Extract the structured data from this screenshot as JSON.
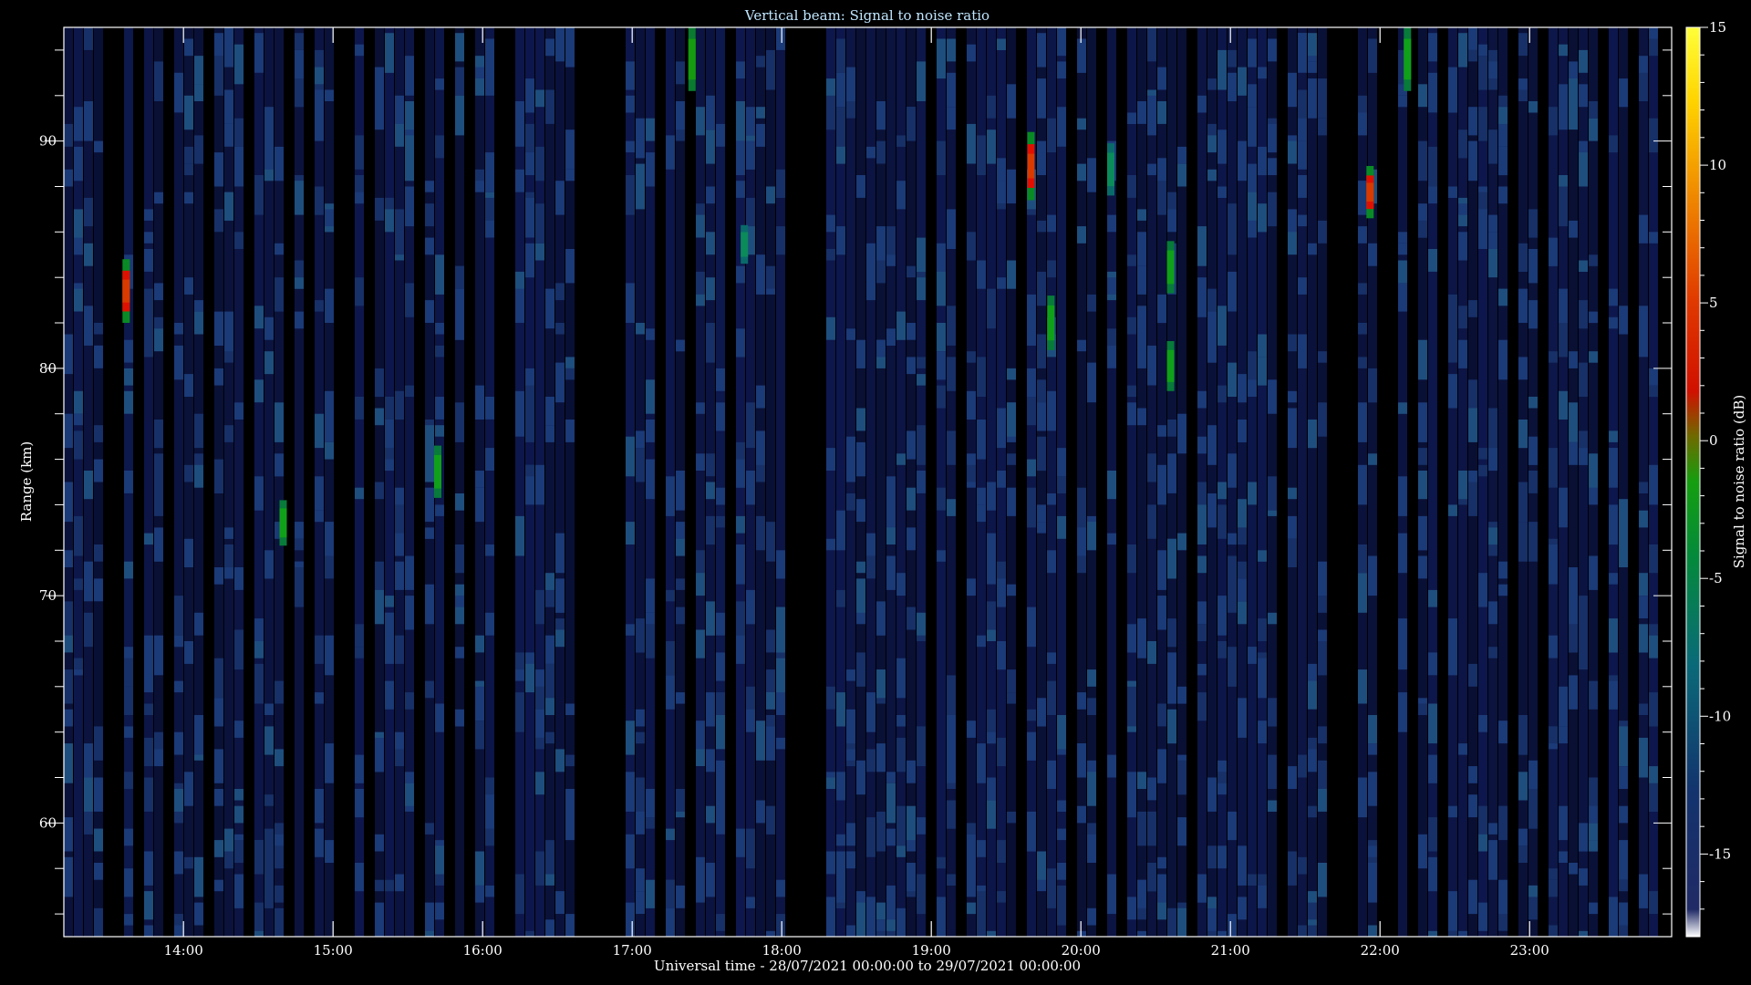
{
  "chart_data": {
    "type": "heatmap",
    "title": "Vertical beam: Signal to noise ratio",
    "xlabel": "Universal time - 28/07/2021 00:00:00 to 29/07/2021 00:00:00",
    "ylabel": "Range (km)",
    "colorbar_label": "Signal to noise ratio (dB)",
    "xlim_hours": [
      13.2,
      23.95
    ],
    "ylim": [
      55,
      95
    ],
    "x_ticks": [
      "14:00",
      "15:00",
      "16:00",
      "17:00",
      "18:00",
      "19:00",
      "20:00",
      "21:00",
      "22:00",
      "23:00"
    ],
    "x_tick_hours": [
      14,
      15,
      16,
      17,
      18,
      19,
      20,
      21,
      22,
      23
    ],
    "y_ticks": [
      "60",
      "70",
      "80",
      "90"
    ],
    "y_tick_values": [
      60,
      70,
      80,
      90
    ],
    "colorbar_range": [
      -18,
      15
    ],
    "colorbar_ticks": [
      "15",
      "10",
      "5",
      "0",
      "-5",
      "-10",
      "-15"
    ],
    "colorbar_tick_values": [
      15,
      10,
      5,
      0,
      -5,
      -10,
      -15
    ],
    "background_level_db": -15,
    "data_gap_hours": [
      16.65,
      16.88
    ],
    "echoes": [
      {
        "time": "13:37",
        "range_km": [
          82,
          84.8
        ],
        "peak_db": 2
      },
      {
        "time": "14:40",
        "range_km": [
          72.2,
          74.2
        ],
        "peak_db": -6
      },
      {
        "time": "15:42",
        "range_km": [
          74.3,
          76.6
        ],
        "peak_db": -5
      },
      {
        "time": "17:24",
        "range_km": [
          92.2,
          95
        ],
        "peak_db": -2
      },
      {
        "time": "17:45",
        "range_km": [
          84.6,
          86.3
        ],
        "peak_db": -10
      },
      {
        "time": "19:40",
        "range_km": [
          87.4,
          90.4
        ],
        "peak_db": 2
      },
      {
        "time": "19:48",
        "range_km": [
          80.8,
          83.2
        ],
        "peak_db": -6
      },
      {
        "time": "20:12",
        "range_km": [
          87.6,
          89.9
        ],
        "peak_db": -8
      },
      {
        "time": "20:36",
        "range_km": [
          83.3,
          85.6
        ],
        "peak_db": -6
      },
      {
        "time": "20:36",
        "range_km": [
          79,
          81.2
        ],
        "peak_db": -7
      },
      {
        "time": "21:56",
        "range_km": [
          86.6,
          88.9
        ],
        "peak_db": 1
      },
      {
        "time": "22:11",
        "range_km": [
          92.2,
          95
        ],
        "peak_db": -5
      }
    ],
    "colors": {
      "background": "#000000",
      "noise": "#14205a",
      "axes": "#ffffff",
      "title": "#bfe6ff"
    }
  }
}
